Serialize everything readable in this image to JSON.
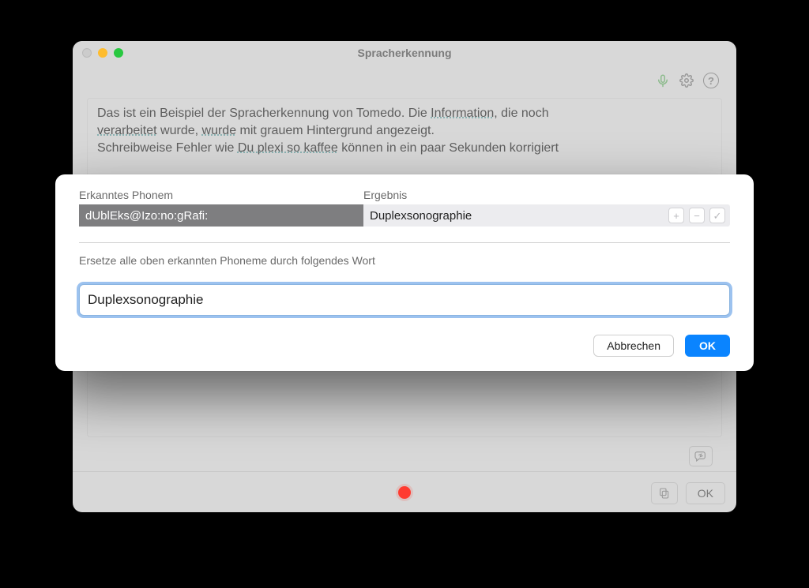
{
  "window": {
    "title": "Spracherkennung"
  },
  "editor": {
    "line1_a": "Das ist ein Beispiel der Spracherkennung von Tomedo. Die ",
    "line1_b": "Information",
    "line1_c": ", die noch",
    "line2_a": "verarbeitet",
    "line2_b": " wurde, ",
    "line2_c": "wurde",
    "line2_d": " mit grauem Hintergrund angezeigt.",
    "line3_a": "Schreibweise Fehler wie ",
    "line3_b": "Du plexi so kaffee",
    "line3_c": "  können in ein paar Sekunden korrigiert"
  },
  "sheet": {
    "col_phoneme": "Erkanntes Phonem",
    "col_result": "Ergebnis",
    "row_phoneme": "dUblEks@Izo:no:gRafi:",
    "row_result": "Duplexsonographie",
    "replace_label": "Ersetze alle oben erkannten Phoneme durch folgendes Wort",
    "input_value": "Duplexsonographie",
    "cancel": "Abbrechen",
    "ok": "OK",
    "plus": "+",
    "minus": "−",
    "check": "✓"
  },
  "parent_buttons": {
    "ok": "OK",
    "help_glyph": "?"
  }
}
